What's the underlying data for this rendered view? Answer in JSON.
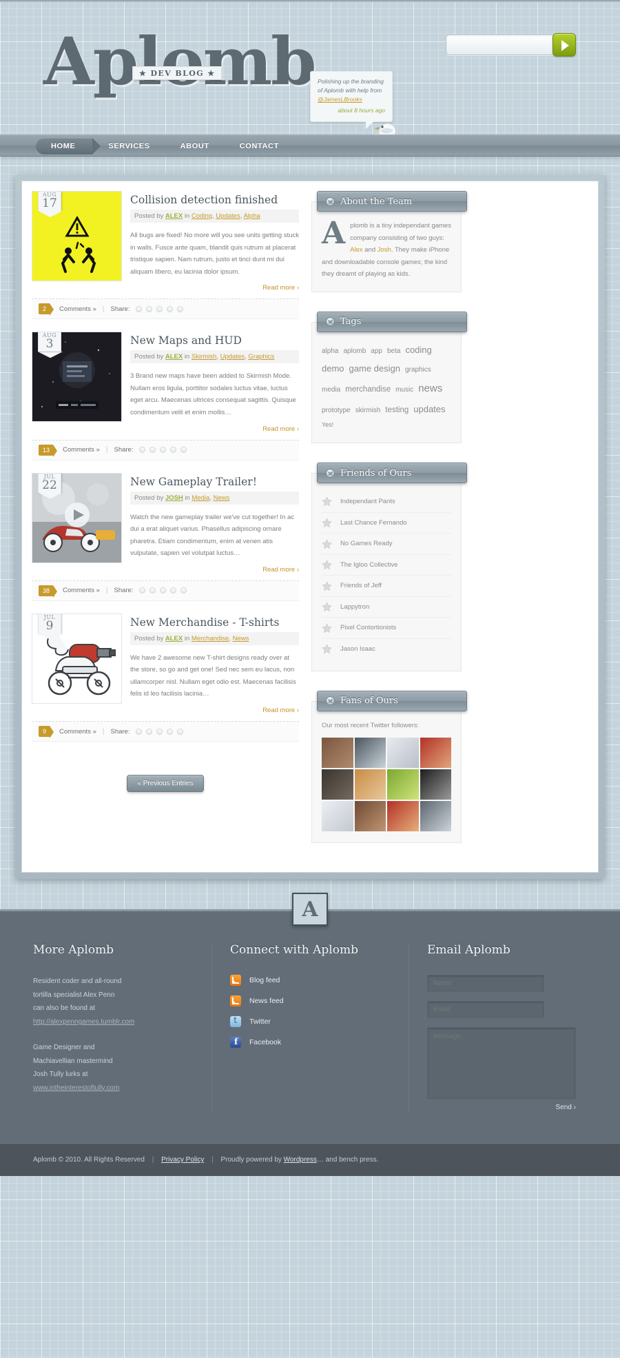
{
  "site": {
    "logo": "Aplomb",
    "tagline": "★ DEV BLOG ★"
  },
  "search": {
    "value": "",
    "placeholder": "",
    "button_label": "go"
  },
  "tweet": {
    "line1": "Polishing up the branding",
    "line2": "of Aplomb with help from",
    "handle": "@JamesLBrooks",
    "ago": "about 8 hours ago"
  },
  "nav": {
    "items": [
      {
        "label": "HOME",
        "active": true
      },
      {
        "label": "SERVICES",
        "active": false
      },
      {
        "label": "ABOUT",
        "active": false
      },
      {
        "label": "CONTACT",
        "active": false
      }
    ]
  },
  "posts": [
    {
      "month": "AUG",
      "day": "17",
      "title": "Collision detection finished",
      "posted_by_label": "Posted by",
      "author": "ALEX",
      "in_label": "in",
      "categories": [
        "Coding",
        "Updates",
        "Alpha"
      ],
      "excerpt": "All bugs are fixed! No more will you see units getting stuck in walls. Fusce ante quam, blandit quis rutrum at placerat tristique sapien. Nam rutrum, justo et tinci dunt mi dui aliquam libero, eu lacinia dolor ipsum.",
      "read_more": "Read more ›",
      "comment_count": "2",
      "comments_label": "Comments »",
      "share_label": "Share:",
      "thumb_kind": "warning-yellow"
    },
    {
      "month": "AUG",
      "day": "3",
      "title": "New Maps and HUD",
      "posted_by_label": "Posted by",
      "author": "ALEX",
      "in_label": "in",
      "categories": [
        "Skirmish",
        "Updates",
        "Graphics"
      ],
      "excerpt": "3 Brand new maps have been added to Skirmish Mode. Nullam eros ligula, porttitor sodales luctus vitae, luctus eget arcu. Maecenas ultrices consequat sagittis. Quisque condimentum velit et enim mollis…",
      "read_more": "Read more ›",
      "comment_count": "13",
      "comments_label": "Comments »",
      "share_label": "Share:",
      "thumb_kind": "space-map"
    },
    {
      "month": "JUL",
      "day": "22",
      "title": "New Gameplay Trailer!",
      "posted_by_label": "Posted by",
      "author": "JOSH",
      "in_label": "in",
      "categories": [
        "Media",
        "News"
      ],
      "excerpt": "Watch the new gameplay trailer we've cut together! In ac dui a erat aliquet varius. Phasellus adipiscing ornare pharetra. Etiam condimentum, enim at venen atis vulputate, sapien vel volutpat luctus…",
      "read_more": "Read more ›",
      "comment_count": "38",
      "comments_label": "Comments »",
      "share_label": "Share:",
      "thumb_kind": "video-car"
    },
    {
      "month": "JUL",
      "day": "9",
      "title": "New Merchandise - T-shirts",
      "posted_by_label": "Posted by",
      "author": "ALEX",
      "in_label": "in",
      "categories": [
        "Merchandise",
        "News"
      ],
      "excerpt": "We have 2 awesome new T-shirt designs ready over at the store, so go and get one! Sed nec sem eu lacus, non ullamcorper nisl. Nullam eget odio est. Maecenas facilisis felis id leo facilisis lacinia…",
      "read_more": "Read more ›",
      "comment_count": "9",
      "comments_label": "Comments »",
      "share_label": "Share:",
      "thumb_kind": "robot"
    }
  ],
  "pagination": {
    "previous": "« Previous Entries"
  },
  "widgets": {
    "about": {
      "title": "About the Team",
      "dropcap": "A",
      "text_part1": "plomb is a tiny independant games company consisting of two guys: ",
      "link_alex": "Alex",
      "and_label": " and ",
      "link_josh": "Josh",
      "text_part2": ". They make iPhone and downloadable console games; the kind they dreamt of playing as kids."
    },
    "tags": {
      "title": "Tags",
      "items": [
        {
          "label": "alpha",
          "size": "t2"
        },
        {
          "label": "aplomb",
          "size": "t2"
        },
        {
          "label": "app",
          "size": "t2"
        },
        {
          "label": "beta",
          "size": "t2"
        },
        {
          "label": "coding",
          "size": "t4"
        },
        {
          "label": "demo",
          "size": "t4"
        },
        {
          "label": "game design",
          "size": "t4"
        },
        {
          "label": "graphics",
          "size": "t2"
        },
        {
          "label": "media",
          "size": "t2"
        },
        {
          "label": "merchandise",
          "size": "t3"
        },
        {
          "label": "music",
          "size": "t2"
        },
        {
          "label": "news",
          "size": "t5"
        },
        {
          "label": "prototype",
          "size": "t2"
        },
        {
          "label": "skirmish",
          "size": "t2"
        },
        {
          "label": "testing",
          "size": "t3"
        },
        {
          "label": "updates",
          "size": "t4"
        },
        {
          "label": "Yes!",
          "size": "t1"
        }
      ]
    },
    "friends": {
      "title": "Friends of Ours",
      "items": [
        "Independant Pants",
        "Last Chance Fernando",
        "No Games Ready",
        "The Igloo Collective",
        "Friends of Jeff",
        "Lappytron",
        "Pixel Contortionists",
        "Jason Isaac"
      ]
    },
    "fans": {
      "title": "Fans of Ours",
      "note": "Our most recent Twitter followers:",
      "avatars": [
        {
          "c1": "#7a5640",
          "c2": "#b08b6c"
        },
        {
          "c1": "#4a5560",
          "c2": "#cbd4da"
        },
        {
          "c1": "#e8eaef",
          "c2": "#b9bfc9"
        },
        {
          "c1": "#b23126",
          "c2": "#e0a67a"
        },
        {
          "c1": "#3a3530",
          "c2": "#746a5e"
        },
        {
          "c1": "#c98c46",
          "c2": "#e8c79a"
        },
        {
          "c1": "#7aa82e",
          "c2": "#cfe37a"
        },
        {
          "c1": "#1d1d1d",
          "c2": "#9a9a9a"
        },
        {
          "c1": "#eceff3",
          "c2": "#c3c8d0"
        },
        {
          "c1": "#6d4a33",
          "c2": "#c09572"
        },
        {
          "c1": "#b23126",
          "c2": "#e6b07c"
        },
        {
          "c1": "#5c6570",
          "c2": "#cdd4da"
        }
      ]
    }
  },
  "footer": {
    "badge": "A",
    "col1": {
      "heading": "More Aplomb",
      "p1_line1": "Resident coder and all-round",
      "p1_line2": "tortilla specialist Alex Penn",
      "p1_line3": "can also be found at",
      "p1_url": "http://alexpenngames.tumblr.com",
      "p2_line1": "Game Designer  and",
      "p2_line2": "Machiavellian mastermind",
      "p2_line3": "Josh Tully lurks at",
      "p2_url": "www.intheinterestoftully.com"
    },
    "col2": {
      "heading": "Connect with Aplomb",
      "links": [
        {
          "label": "Blog feed",
          "icon": "rss"
        },
        {
          "label": "News feed",
          "icon": "rss"
        },
        {
          "label": "Twitter",
          "icon": "tw"
        },
        {
          "label": "Facebook",
          "icon": "fb"
        }
      ]
    },
    "col3": {
      "heading": "Email Aplomb",
      "name_placeholder": "Name",
      "email_placeholder": "Email",
      "message_placeholder": "Message...",
      "send_label": "Send ›"
    },
    "copyright": {
      "text1": "Aplomb © 2010. All Rights Reserved",
      "privacy": "Privacy Policy",
      "text2": "Proudly powered by ",
      "wordpress": "Wordpress",
      "text3": "… and bench press."
    }
  },
  "colors": {
    "accent_gold": "#c79a2c",
    "accent_green": "#9fb03c",
    "nav_grey": "#8b99a2",
    "page_bg": "#c5d4dc"
  }
}
